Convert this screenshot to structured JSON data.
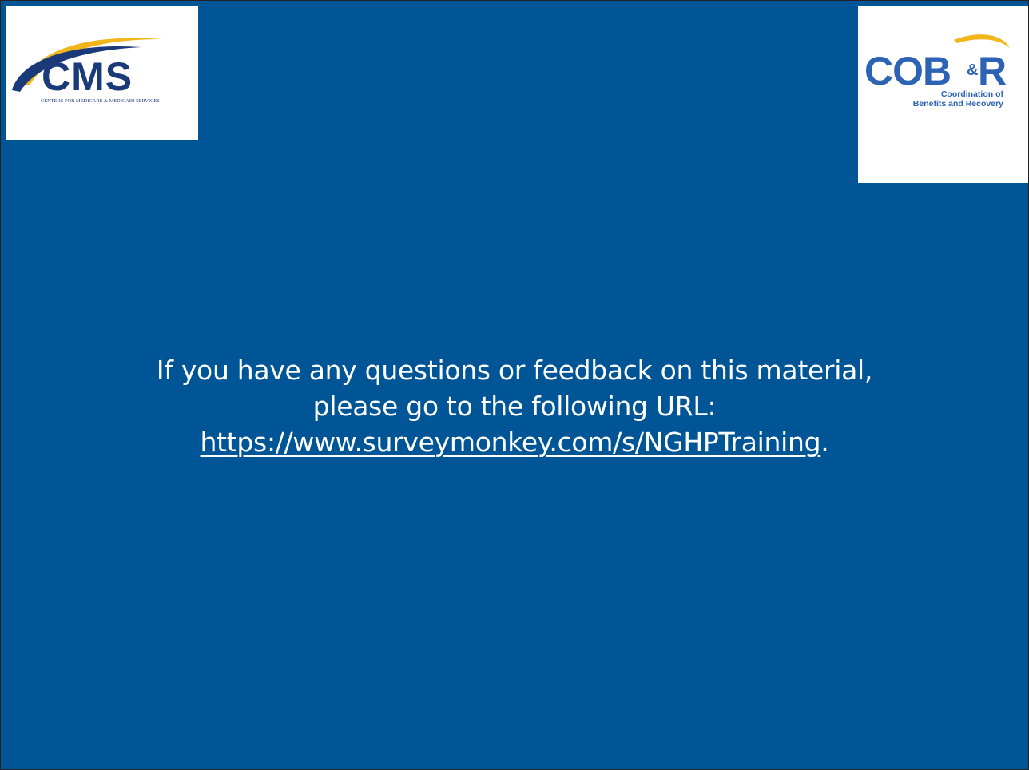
{
  "logos": {
    "cms": {
      "wordmark": "CMS",
      "tagline": "CENTERS FOR MEDICARE & MEDICAID SERVICES",
      "colors": {
        "navy": "#1b3a7a",
        "gold": "#f2b51a"
      }
    },
    "cobr": {
      "wordmark_cob": "COB",
      "wordmark_amp": "&",
      "wordmark_r": "R",
      "tagline_line1": "Coordination of",
      "tagline_line2": "Benefits and Recovery",
      "colors": {
        "blue": "#2c63b5",
        "gold": "#f2b51a"
      }
    }
  },
  "message": {
    "line1": "If you have any questions or feedback on this material,",
    "line2": "please go to the following URL:",
    "link_text": "https://www.surveymonkey.com/s/NGHPTraining",
    "link_suffix": "."
  },
  "colors": {
    "background": "#005597",
    "text": "#ffffff"
  }
}
